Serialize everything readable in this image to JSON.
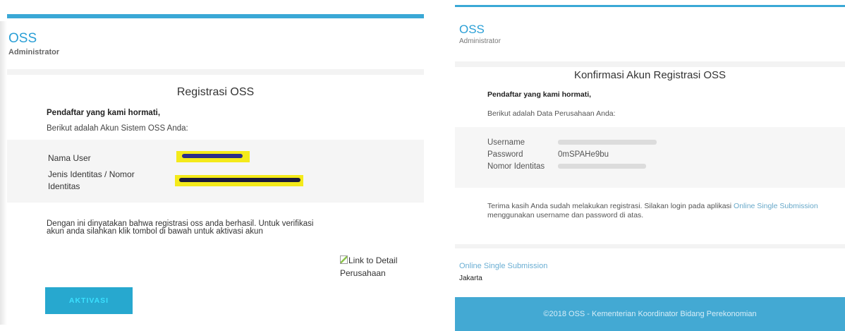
{
  "left_email": {
    "brand": "OSS",
    "brand_sub": "Administrator",
    "title": "Registrasi OSS",
    "greeting": "Pendaftar yang kami hormati,",
    "intro": "Berikut adalah Akun Sistem OSS Anda:",
    "fields": {
      "nama_user_label": "Nama User",
      "identitas_label": "Jenis Identitas / Nomor Identitas"
    },
    "body": "Dengan ini dinyatakan bahwa registrasi oss anda berhasil. Untuk verifikasi akun anda silahkan klik tombol di bawah untuk aktivasi akun",
    "broken_image_alt": "Link to Detail Perusahaan",
    "button_label": "AKTIVASI"
  },
  "right_email": {
    "brand": "OSS",
    "brand_sub": "Administrator",
    "title": "Konfirmasi Akun Registrasi OSS",
    "greeting": "Pendaftar yang kami hormati,",
    "intro": "Berikut adalah Data Perusahaan Anda:",
    "rows": {
      "username_label": "Username",
      "password_label": "Password",
      "password_value": "0mSPAHe9bu",
      "nomor_label": "Nomor Identitas"
    },
    "body_before": "Terima kasih Anda sudah melakukan registrasi. Silakan login pada aplikasi ",
    "body_link": "Online Single Submission",
    "body_after": " menggunakan username dan password di atas.",
    "footer_link": "Online Single Submission",
    "city": "Jakarta",
    "copyright": "©2018 OSS - Kementerian Koordinator Bidang Perekonomian"
  },
  "colors": {
    "accent": "#3aa8d6",
    "button": "#27a8cf",
    "footer": "#43a9d3",
    "redaction": "#f4ea1a"
  }
}
